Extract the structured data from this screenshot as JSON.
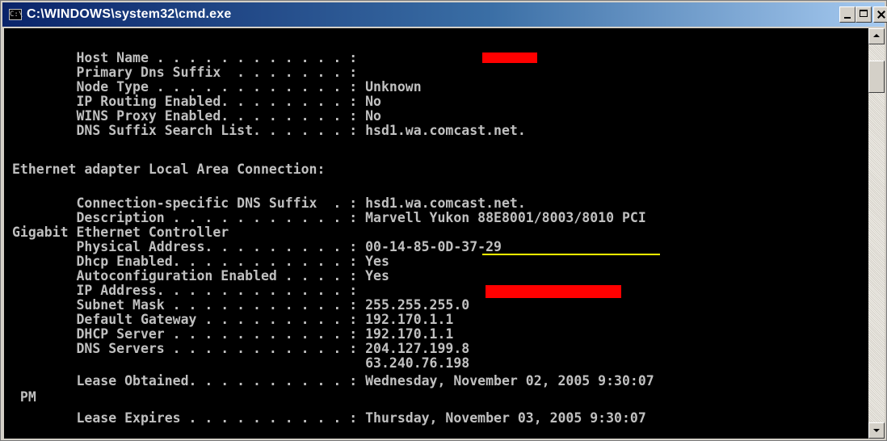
{
  "window": {
    "title": "C:\\WINDOWS\\system32\\cmd.exe",
    "icon_label": "C:\\"
  },
  "console": {
    "lines": [
      "        Host Name . . . . . . . . . . . . : ",
      "        Primary Dns Suffix  . . . . . . . : ",
      "        Node Type . . . . . . . . . . . . : Unknown",
      "        IP Routing Enabled. . . . . . . . : No",
      "        WINS Proxy Enabled. . . . . . . . : No",
      "        DNS Suffix Search List. . . . . . : hsd1.wa.comcast.net.",
      "",
      "Ethernet adapter Local Area Connection:",
      "",
      "        Connection-specific DNS Suffix  . : hsd1.wa.comcast.net.",
      "        Description . . . . . . . . . . . : Marvell Yukon 88E8001/8003/8010 PCI",
      "Gigabit Ethernet Controller",
      "        Physical Address. . . . . . . . . : 00-14-85-0D-37-29",
      "        Dhcp Enabled. . . . . . . . . . . : Yes",
      "        Autoconfiguration Enabled . . . . : Yes",
      "        IP Address. . . . . . . . . . . . : ",
      "        Subnet Mask . . . . . . . . . . . : 255.255.255.0",
      "        Default Gateway . . . . . . . . . : 192.170.1.1",
      "        DHCP Server . . . . . . . . . . . : 192.170.1.1",
      "        DNS Servers . . . . . . . . . . . : 204.127.199.8",
      "                                            63.240.76.198",
      "        Lease Obtained. . . . . . . . . . : Wednesday, November 02, 2005 9:30:07",
      " PM",
      "        Lease Expires . . . . . . . . . . : Thursday, November 03, 2005 9:30:07"
    ]
  },
  "colors": {
    "console_bg": "#000000",
    "console_text": "#c0c0c0",
    "redaction": "#ff0000",
    "highlight_underline": "#ffff00",
    "titlebar_start": "#0a246a",
    "titlebar_end": "#a6caf0"
  },
  "icons": {
    "window_icon": "cmd-icon",
    "minimize": "minimize-icon",
    "maximize": "maximize-icon",
    "close": "close-icon",
    "scroll_up": "arrow-up-icon",
    "scroll_down": "arrow-down-icon"
  }
}
